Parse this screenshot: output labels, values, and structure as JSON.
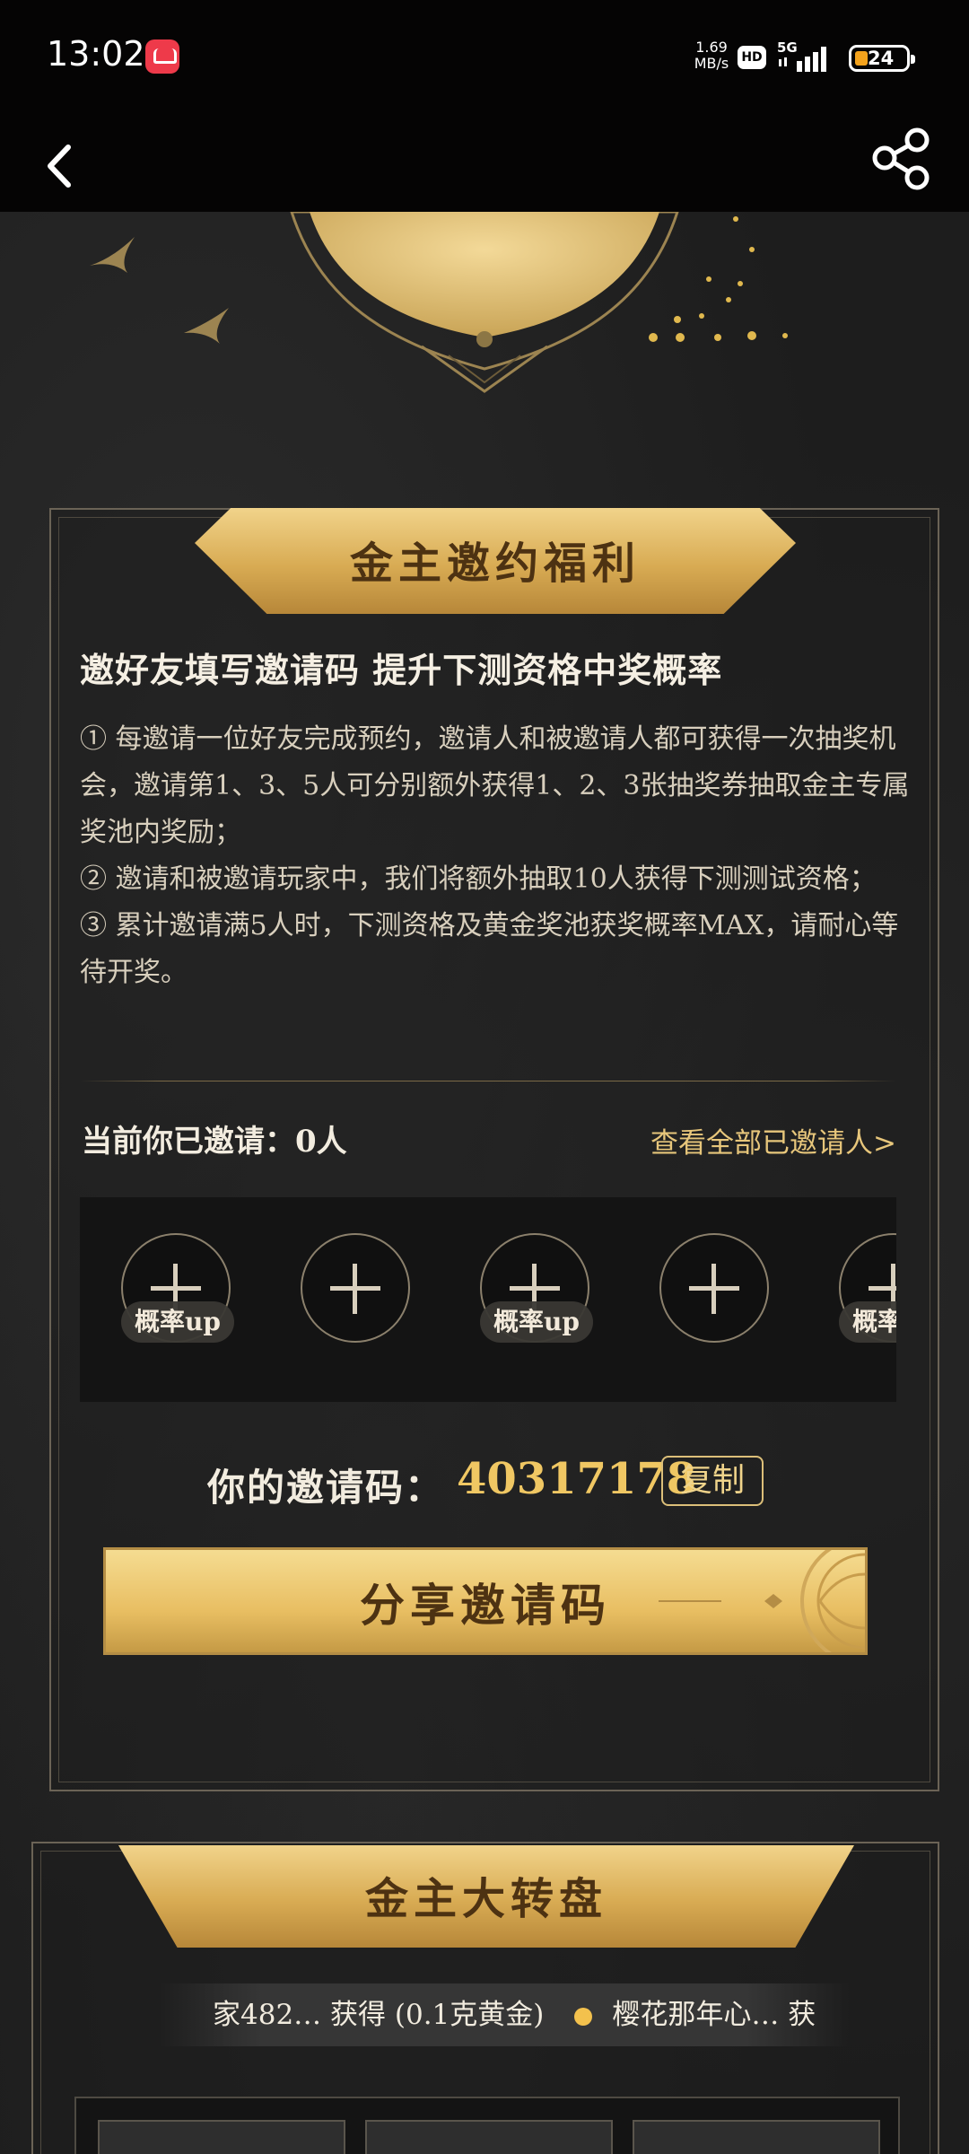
{
  "status_bar": {
    "time": "13:02",
    "net_speed": "1.69",
    "net_unit": "MB/s",
    "hd": "HD",
    "network": "5G",
    "battery": "24"
  },
  "icons": {
    "back": "back-arrow-icon",
    "share": "share-icon"
  },
  "invite_panel": {
    "title": "金主邀约福利",
    "headline": "邀好友填写邀请码 提升下测资格中奖概率",
    "rules": [
      "① 每邀请一位好友完成预约，邀请人和被邀请人都可获得一次抽奖机会，邀请第1、3、5人可分别额外获得1、2、3张抽奖券抽取金主专属奖池内奖励；",
      "② 邀请和被邀请玩家中，我们将额外抽取10人获得下测测试资格；",
      "③ 累计邀请满5人时，下测资格及黄金奖池获奖概率MAX，请耐心等待开奖。"
    ],
    "invited_label": "当前你已邀请：0人",
    "view_all": "查看全部已邀请人>",
    "slot_tag": "概率up",
    "code_label": "你的邀请码：",
    "code_value": "40317178",
    "copy_label": "复制",
    "share_button": "分享邀请码"
  },
  "wheel_panel": {
    "title": "金主大转盘",
    "ticker_items": [
      "家482…  获得 (0.1克黄金)",
      "樱花那年心…  获"
    ]
  },
  "colors": {
    "accent_gold": "#f0c763",
    "ribbon_gold": "#d8ab53",
    "text_dark_brown": "#4d3212"
  }
}
